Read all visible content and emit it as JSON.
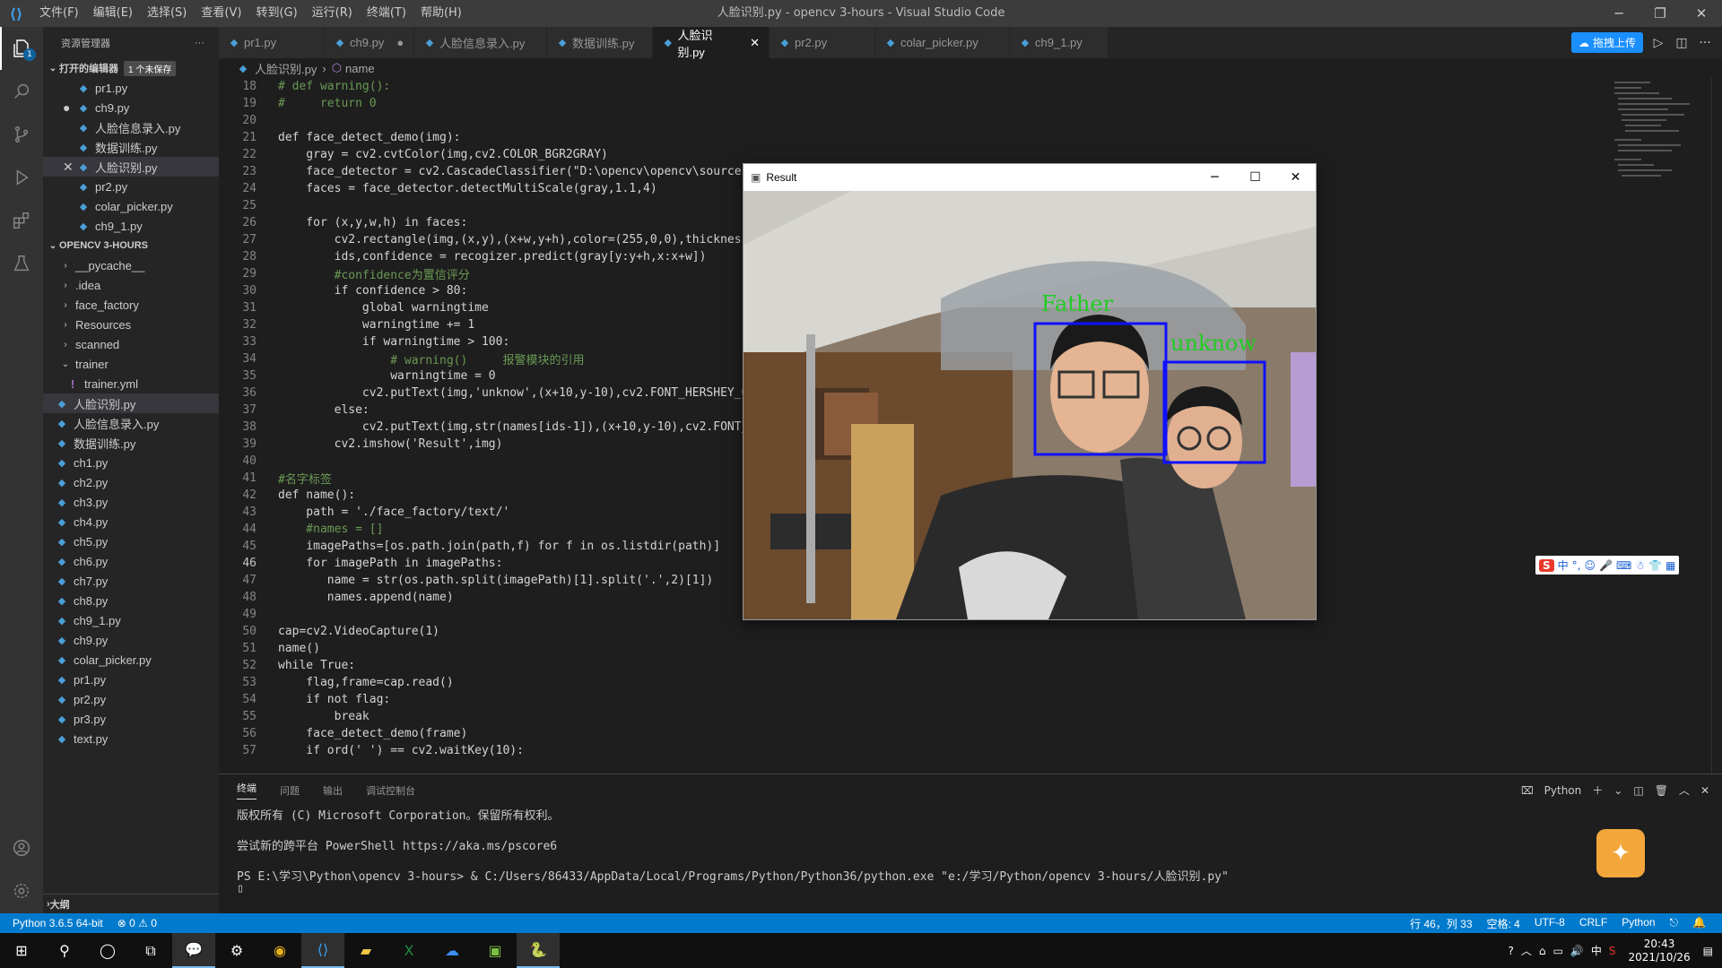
{
  "window": {
    "title": "人脸识别.py - opencv 3-hours - Visual Studio Code"
  },
  "menu": [
    "文件(F)",
    "编辑(E)",
    "选择(S)",
    "查看(V)",
    "转到(G)",
    "运行(R)",
    "终端(T)",
    "帮助(H)"
  ],
  "sidebar": {
    "header": "资源管理器",
    "open_editors": {
      "label": "打开的编辑器",
      "badge": "1 个未保存",
      "files": [
        {
          "name": "pr1.py",
          "mark": ""
        },
        {
          "name": "ch9.py",
          "mark": "●"
        },
        {
          "name": "人脸信息录入.py",
          "mark": ""
        },
        {
          "name": "数据训练.py",
          "mark": ""
        },
        {
          "name": "人脸识别.py",
          "mark": "✕"
        },
        {
          "name": "pr2.py",
          "mark": ""
        },
        {
          "name": "colar_picker.py",
          "mark": ""
        },
        {
          "name": "ch9_1.py",
          "mark": ""
        }
      ]
    },
    "project": {
      "label": "OPENCV 3-HOURS",
      "folders": [
        "__pycache__",
        ".idea",
        "face_factory",
        "Resources",
        "scanned"
      ],
      "trainer": {
        "name": "trainer",
        "file": "trainer.yml"
      },
      "files": [
        "人脸识别.py",
        "人脸信息录入.py",
        "数据训练.py",
        "ch1.py",
        "ch2.py",
        "ch3.py",
        "ch4.py",
        "ch5.py",
        "ch6.py",
        "ch7.py",
        "ch8.py",
        "ch9_1.py",
        "ch9.py",
        "colar_picker.py",
        "pr1.py",
        "pr2.py",
        "pr3.py",
        "text.py"
      ]
    },
    "outline": "大纲"
  },
  "tabs": [
    {
      "label": "pr1.py",
      "suffix": ""
    },
    {
      "label": "ch9.py",
      "suffix": "●"
    },
    {
      "label": "人脸信息录入.py",
      "suffix": ""
    },
    {
      "label": "数据训练.py",
      "suffix": ""
    },
    {
      "label": "人脸识别.py",
      "suffix": "✕"
    },
    {
      "label": "pr2.py",
      "suffix": ""
    },
    {
      "label": "colar_picker.py",
      "suffix": ""
    },
    {
      "label": "ch9_1.py",
      "suffix": ""
    }
  ],
  "baidu_label": "拖拽上传",
  "breadcrumb": {
    "file": "人脸识别.py",
    "symbol": "name"
  },
  "code": [
    {
      "n": "18",
      "t": "# def warning():"
    },
    {
      "n": "19",
      "t": "#     return 0"
    },
    {
      "n": "20",
      "t": ""
    },
    {
      "n": "21",
      "t": "def face_detect_demo(img):"
    },
    {
      "n": "22",
      "t": "    gray = cv2.cvtColor(img,cv2.COLOR_BGR2GRAY)"
    },
    {
      "n": "23",
      "t": "    face_detector = cv2.CascadeClassifier(\"D:\\opencv\\opencv\\sources"
    },
    {
      "n": "24",
      "t": "    faces = face_detector.detectMultiScale(gray,1.1,4)"
    },
    {
      "n": "25",
      "t": ""
    },
    {
      "n": "26",
      "t": "    for (x,y,w,h) in faces:"
    },
    {
      "n": "27",
      "t": "        cv2.rectangle(img,(x,y),(x+w,y+h),color=(255,0,0),thickness"
    },
    {
      "n": "28",
      "t": "        ids,confidence = recogizer.predict(gray[y:y+h,x:x+w])"
    },
    {
      "n": "29",
      "t": "        #confidence为置信评分"
    },
    {
      "n": "30",
      "t": "        if confidence > 80:"
    },
    {
      "n": "31",
      "t": "            global warningtime"
    },
    {
      "n": "32",
      "t": "            warningtime += 1"
    },
    {
      "n": "33",
      "t": "            if warningtime > 100:"
    },
    {
      "n": "34",
      "t": "                # warning()     报警模块的引用"
    },
    {
      "n": "35",
      "t": "                warningtime = 0"
    },
    {
      "n": "36",
      "t": "            cv2.putText(img,'unknow',(x+10,y-10),cv2.FONT_HERSHEY_C"
    },
    {
      "n": "37",
      "t": "        else:"
    },
    {
      "n": "38",
      "t": "            cv2.putText(img,str(names[ids-1]),(x+10,y-10),cv2.FONT_"
    },
    {
      "n": "39",
      "t": "        cv2.imshow('Result',img)"
    },
    {
      "n": "40",
      "t": ""
    },
    {
      "n": "41",
      "t": "#名字标签"
    },
    {
      "n": "42",
      "t": "def name():"
    },
    {
      "n": "43",
      "t": "    path = './face_factory/text/'"
    },
    {
      "n": "44",
      "t": "    #names = []"
    },
    {
      "n": "45",
      "t": "    imagePaths=[os.path.join(path,f) for f in os.listdir(path)]"
    },
    {
      "n": "46",
      "t": "    for imagePath in imagePaths:"
    },
    {
      "n": "47",
      "t": "       name = str(os.path.split(imagePath)[1].split('.',2)[1])"
    },
    {
      "n": "48",
      "t": "       names.append(name)"
    },
    {
      "n": "49",
      "t": ""
    },
    {
      "n": "50",
      "t": "cap=cv2.VideoCapture(1)"
    },
    {
      "n": "51",
      "t": "name()"
    },
    {
      "n": "52",
      "t": "while True:"
    },
    {
      "n": "53",
      "t": "    flag,frame=cap.read()"
    },
    {
      "n": "54",
      "t": "    if not flag:"
    },
    {
      "n": "55",
      "t": "        break"
    },
    {
      "n": "56",
      "t": "    face_detect_demo(frame)"
    },
    {
      "n": "57",
      "t": "    if ord(' ') == cv2.waitKey(10):"
    }
  ],
  "panel": {
    "tabs": [
      "终端",
      "问题",
      "输出",
      "调试控制台"
    ],
    "shell": "Python",
    "lines": [
      "版权所有 (C) Microsoft Corporation。保留所有权利。",
      "",
      "尝试新的跨平台 PowerShell https://aka.ms/pscore6",
      "",
      "PS E:\\学习\\Python\\opencv 3-hours> & C:/Users/86433/AppData/Local/Programs/Python/Python36/python.exe \"e:/学习/Python/opencv 3-hours/人脸识别.py\""
    ]
  },
  "result_window": {
    "title": "Result",
    "labels": {
      "left": "Father",
      "right": "unknow"
    }
  },
  "status": {
    "python": "Python 3.6.5 64-bit",
    "problems": "⊗ 0 ⚠ 0",
    "position": "行 46，列 33",
    "spaces": "空格: 4",
    "encoding": "UTF-8",
    "eol": "CRLF",
    "lang": "Python"
  },
  "taskbar": {
    "time": "20:43",
    "date": "2021/10/26",
    "ime": "中"
  }
}
